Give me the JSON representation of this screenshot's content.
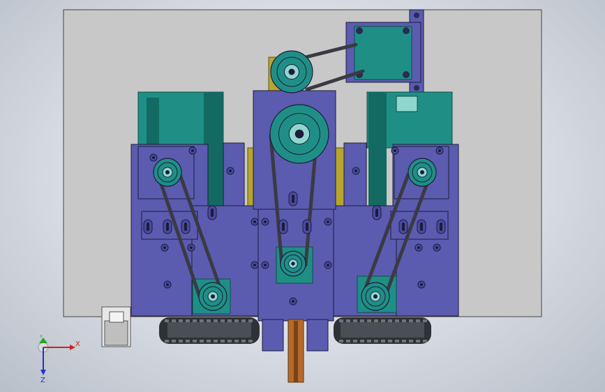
{
  "view": {
    "type": "cad-assembly-front-view",
    "background_top": "#f4f6f9",
    "background_edge": "#b9bfc9"
  },
  "colors": {
    "base_plate": "#c8c8c8",
    "motor_bracket": "#5b5bb0",
    "motor_body": "#1f8f86",
    "motor_dark": "#136a63",
    "pulley": "#1f8f86",
    "belt": "#3a3a44",
    "spacer_plate": "#b7a52e",
    "chain": "#2e3236",
    "shaft": "#b46a2c",
    "bolt": "#2a2a55",
    "outline": "#1c1c3a"
  },
  "triad": {
    "x_label": "X",
    "y_label": "Y",
    "z_label": "Z",
    "x_color": "#cc2222",
    "y_color": "#22aa22",
    "z_color": "#2233cc"
  }
}
